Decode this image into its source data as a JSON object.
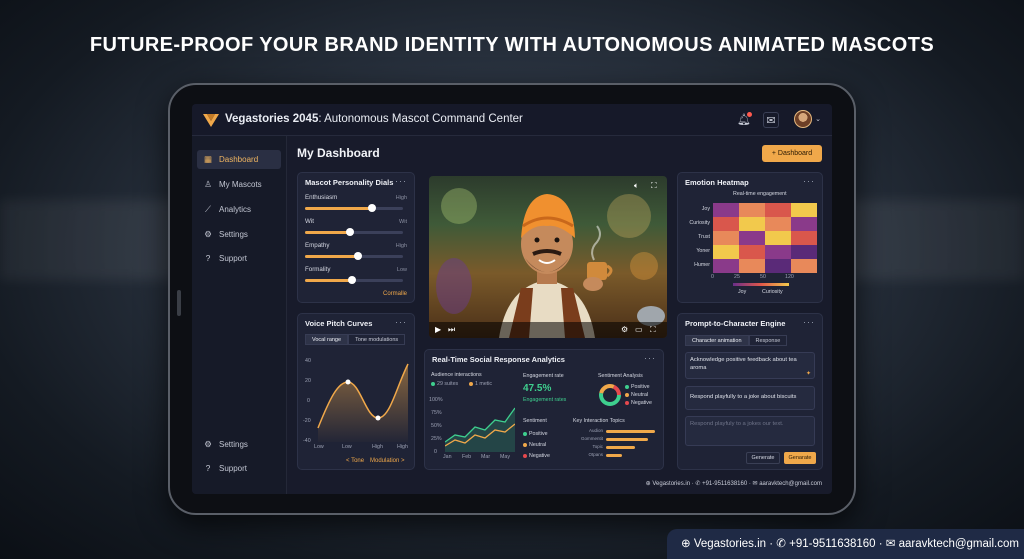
{
  "headline": "FUTURE-PROOF YOUR BRAND IDENTITY WITH AUTONOMOUS ANIMATED MASCOTS",
  "app": {
    "title_bold": "Vegastories 2045",
    "title_rest": ": Autonomous Mascot Command Center"
  },
  "sidebar": {
    "items": [
      {
        "label": "Dashboard",
        "icon": "grid-icon"
      },
      {
        "label": "My Mascots",
        "icon": "user-icon"
      },
      {
        "label": "Analytics",
        "icon": "chart-icon"
      },
      {
        "label": "Settings",
        "icon": "gear-icon"
      },
      {
        "label": "Support",
        "icon": "help-icon"
      }
    ],
    "bottom_items": [
      {
        "label": "Settings",
        "icon": "gear-icon"
      },
      {
        "label": "Support",
        "icon": "help-icon"
      }
    ]
  },
  "main": {
    "title": "My Dashboard",
    "add_button": "+ Dashboard"
  },
  "personality": {
    "title": "Mascot Personality Dials",
    "dials": [
      {
        "label": "Enthusiasm",
        "right": "High",
        "value": 0.68
      },
      {
        "label": "Wit",
        "right": "Wit",
        "value": 0.46
      },
      {
        "label": "Empathy",
        "right": "High",
        "value": 0.54
      },
      {
        "label": "Formality",
        "right": "Low",
        "value": 0.48
      }
    ],
    "link": "Cormalle"
  },
  "pitch": {
    "title": "Voice Pitch Curves",
    "tabs": [
      "Vocal range",
      "Tone modulations"
    ],
    "y_ticks": [
      "40",
      "20",
      "0",
      "-20",
      "-40"
    ],
    "x_ticks": [
      "Low",
      "Low",
      "High",
      "High"
    ],
    "footer_left": "< Tone",
    "footer_right": "Modulation >"
  },
  "heatmap": {
    "title": "Emotion Heatmap",
    "subtitle": "Real-time engagement",
    "rows": [
      "Joy",
      "Curiosity",
      "Trust",
      "Yoner",
      "Humer"
    ],
    "x_ticks": [
      "0",
      "25",
      "50",
      "120"
    ],
    "legend_left": "Joy",
    "legend_right": "Curiosity"
  },
  "social": {
    "title": "Real-Time Social Response Analytics",
    "audience_label": "Audience interactions",
    "legend1": "29 suites",
    "legend2": "1 metic",
    "y_ticks": [
      "100%",
      "75%",
      "50%",
      "25%",
      "0"
    ],
    "x_ticks": [
      "Jan",
      "Feb",
      "Mar",
      "May"
    ],
    "engagement_label": "Engagement rate",
    "engagement_value": "47.5%",
    "engagement_sub": "Engagement rates",
    "sentiment_label": "Sentiment",
    "sentiment_items": [
      "Positive",
      "Neutral",
      "Negative"
    ],
    "analysis_title": "Sentiment Analysis",
    "analysis_items": [
      "Positive",
      "Neutral",
      "Negative"
    ],
    "topics_title": "Key Interaction Topics",
    "topics": [
      {
        "label": "Audion",
        "value": 0.95
      },
      {
        "label": "Gommentit",
        "value": 0.8
      },
      {
        "label": "Topic",
        "value": 0.55
      },
      {
        "label": "Otpans",
        "value": 0.3
      }
    ]
  },
  "prompt": {
    "title": "Prompt-to-Character Engine",
    "tabs": [
      "Character animation",
      "Response"
    ],
    "msg1": "Acknowledge positive feedback about tea aroma",
    "msg2": "Respond playfully to a joke about biscuits",
    "placeholder": "Respond playfuly to a jokes our text.",
    "btn_generate": "Generate",
    "btn_genarate": "Genarate"
  },
  "footer": "⊕ Vegastories.in · ✆ +91-9511638160 · ✉ aaravktech@gmail.com",
  "bottom_bar": "⊕ Vegastories.in · ✆ +91-9511638160 · ✉ aaravktech@gmail.com",
  "colors": {
    "accent": "#f0a84a",
    "positive": "#3ecf8e",
    "neutral": "#f0a84a",
    "negative": "#e5484d"
  }
}
